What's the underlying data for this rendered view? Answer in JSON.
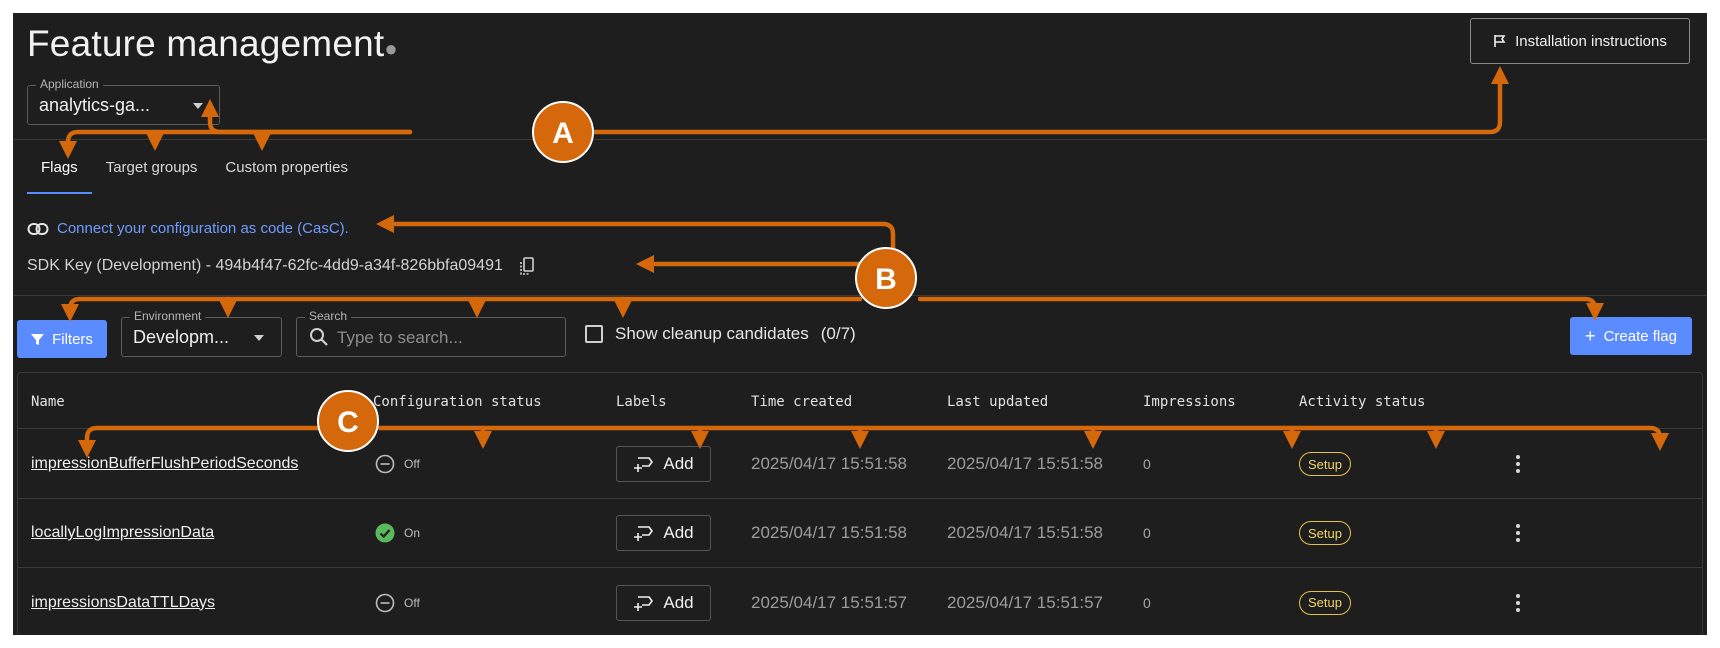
{
  "header": {
    "title": "Feature management",
    "install_button": "Installation instructions"
  },
  "application": {
    "label": "Application",
    "value": "analytics-ga..."
  },
  "tabs": [
    {
      "label": "Flags",
      "active": true
    },
    {
      "label": "Target groups",
      "active": false
    },
    {
      "label": "Custom properties",
      "active": false
    }
  ],
  "casc": {
    "link_text": "Connect your configuration as code (CasC)."
  },
  "sdk": {
    "text": "SDK Key (Development) - 494b4f47-62fc-4dd9-a34f-826bbfa09491"
  },
  "toolbar": {
    "filters_label": "Filters",
    "environment_label": "Environment",
    "environment_value": "Developm...",
    "search_label": "Search",
    "search_placeholder": "Type to search...",
    "cleanup_label": "Show cleanup candidates",
    "cleanup_count": "(0/7)",
    "create_label": "Create flag"
  },
  "table": {
    "columns": [
      "Name",
      "Configuration status",
      "Labels",
      "Time created",
      "Last updated",
      "Impressions",
      "Activity status"
    ],
    "rows": [
      {
        "name": "impressionBufferFlushPeriodSeconds",
        "status": "Off",
        "status_on": false,
        "label_button": "Add",
        "created": "2025/04/17 15:51:58",
        "updated": "2025/04/17 15:51:58",
        "impressions": "0",
        "activity": "Setup"
      },
      {
        "name": "locallyLogImpressionData",
        "status": "On",
        "status_on": true,
        "label_button": "Add",
        "created": "2025/04/17 15:51:58",
        "updated": "2025/04/17 15:51:58",
        "impressions": "0",
        "activity": "Setup"
      },
      {
        "name": "impressionsDataTTLDays",
        "status": "Off",
        "status_on": false,
        "label_button": "Add",
        "created": "2025/04/17 15:51:57",
        "updated": "2025/04/17 15:51:57",
        "impressions": "0",
        "activity": "Setup"
      }
    ]
  },
  "annotations": {
    "a": "A",
    "b": "B",
    "c": "C",
    "color": "#d4680b"
  },
  "colors": {
    "background": "#1e1e1e",
    "accent": "#5b8cff",
    "link": "#6f9cff",
    "success": "#5cb85c",
    "setup_badge": "#e7c24a"
  }
}
